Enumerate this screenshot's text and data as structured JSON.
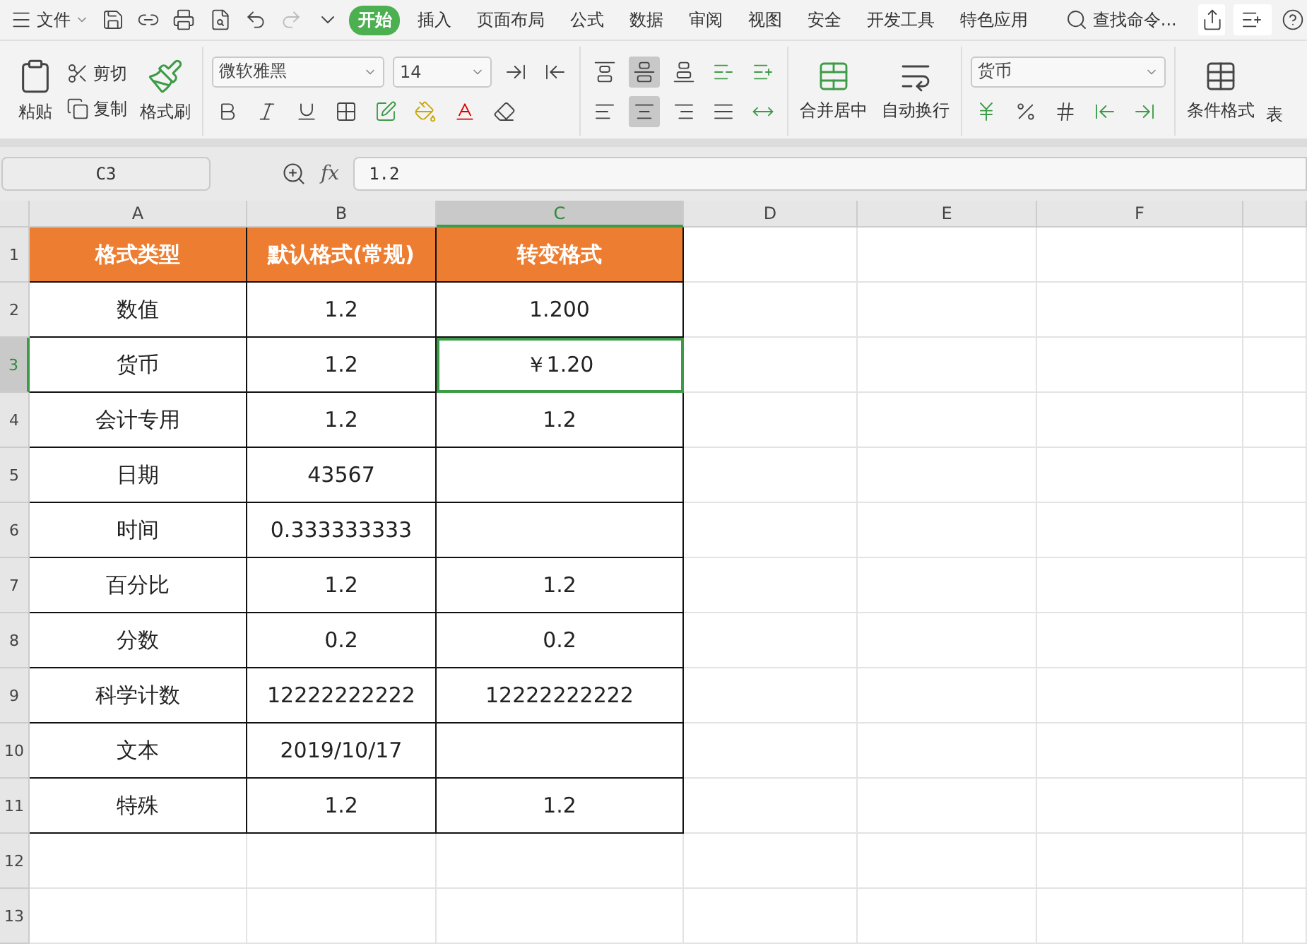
{
  "menu": {
    "file": "文件"
  },
  "tabs": [
    {
      "label": "开始",
      "selected": true
    },
    {
      "label": "插入",
      "selected": false
    },
    {
      "label": "页面布局",
      "selected": false
    },
    {
      "label": "公式",
      "selected": false
    },
    {
      "label": "数据",
      "selected": false
    },
    {
      "label": "审阅",
      "selected": false
    },
    {
      "label": "视图",
      "selected": false
    },
    {
      "label": "安全",
      "selected": false
    },
    {
      "label": "开发工具",
      "selected": false
    },
    {
      "label": "特色应用",
      "selected": false
    }
  ],
  "search": {
    "placeholder": "查找命令..."
  },
  "ribbon": {
    "paste": "粘贴",
    "cut": "剪切",
    "copy": "复制",
    "format_painter": "格式刷",
    "font_name": "微软雅黑",
    "font_size": "14",
    "vertical_align": [
      {
        "selected": false
      },
      {
        "selected": true
      },
      {
        "selected": false
      }
    ],
    "horizontal_align": [
      {
        "selected": false
      },
      {
        "selected": true
      },
      {
        "selected": false
      }
    ],
    "merge": "合并居中",
    "wrap": "自动换行",
    "number_format": "货币",
    "conditional_format": "条件格式",
    "next_button": "表"
  },
  "formula_bar": {
    "name_box": "C3",
    "function_label": "fx",
    "formula": "1.2"
  },
  "grid": {
    "columns": [
      {
        "label": "A",
        "selected": false
      },
      {
        "label": "B",
        "selected": false
      },
      {
        "label": "C",
        "selected": true
      },
      {
        "label": "D",
        "selected": false
      },
      {
        "label": "E",
        "selected": false
      },
      {
        "label": "F",
        "selected": false
      }
    ],
    "rows": [
      {
        "number": "1",
        "selected": false,
        "kind": "header",
        "cells": [
          "格式类型",
          "默认格式(常规)",
          "转变格式"
        ]
      },
      {
        "number": "2",
        "selected": false,
        "kind": "data",
        "cells": [
          "数值",
          "1.2",
          "1.200"
        ]
      },
      {
        "number": "3",
        "selected": true,
        "kind": "data",
        "cells": [
          "货币",
          "1.2",
          "￥1.20"
        ]
      },
      {
        "number": "4",
        "selected": false,
        "kind": "data",
        "cells": [
          "会计专用",
          "1.2",
          "1.2"
        ]
      },
      {
        "number": "5",
        "selected": false,
        "kind": "data",
        "cells": [
          "日期",
          "43567"
        ]
      },
      {
        "number": "6",
        "selected": false,
        "kind": "data",
        "cells": [
          "时间",
          "0.333333333"
        ]
      },
      {
        "number": "7",
        "selected": false,
        "kind": "data",
        "cells": [
          "百分比",
          "1.2",
          "1.2"
        ]
      },
      {
        "number": "8",
        "selected": false,
        "kind": "data",
        "cells": [
          "分数",
          "0.2",
          "0.2"
        ]
      },
      {
        "number": "9",
        "selected": false,
        "kind": "data",
        "cells": [
          "科学计数",
          "12222222222",
          "12222222222"
        ]
      },
      {
        "number": "10",
        "selected": false,
        "kind": "data",
        "cells": [
          "文本",
          "2019/10/17"
        ]
      },
      {
        "number": "11",
        "selected": false,
        "kind": "data",
        "cells": [
          "特殊",
          "1.2",
          "1.2"
        ]
      },
      {
        "number": "12",
        "selected": false,
        "kind": "empty"
      },
      {
        "number": "13",
        "selected": false,
        "kind": "empty"
      }
    ]
  }
}
